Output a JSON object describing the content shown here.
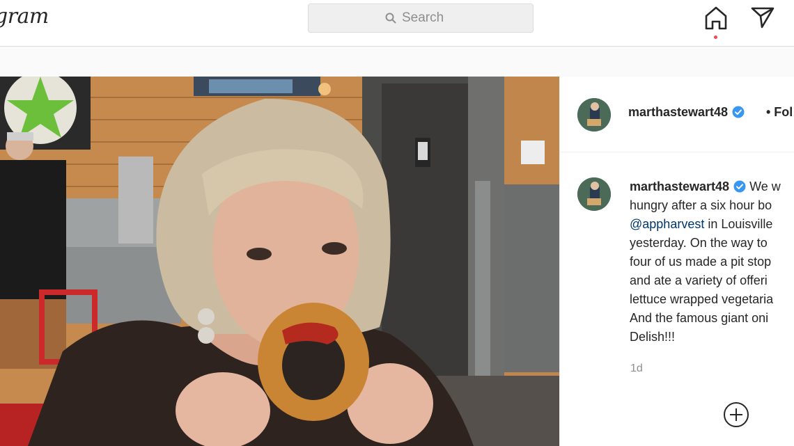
{
  "header": {
    "logo_text": "gram",
    "search_placeholder": "Search"
  },
  "post": {
    "username": "marthastewart48",
    "follow_label": "• Fol",
    "caption_lines": [
      "We w",
      "hungry after a six hour bo",
      "@appharvest",
      " in Louisville",
      "yesterday. On the way to",
      "four of us made a pit stop",
      "and ate a variety of offeri",
      "lettuce wrapped vegetaria",
      "And the famous giant oni",
      "Delish!!!"
    ],
    "timestamp": "1d"
  },
  "colors": {
    "verified_blue": "#3897f0",
    "notification_red": "#ed4956",
    "link_blue": "#00376b"
  },
  "icons": {
    "home": "home-icon",
    "direct": "paper-plane-icon",
    "search": "search-icon",
    "add": "add-circle-icon"
  }
}
